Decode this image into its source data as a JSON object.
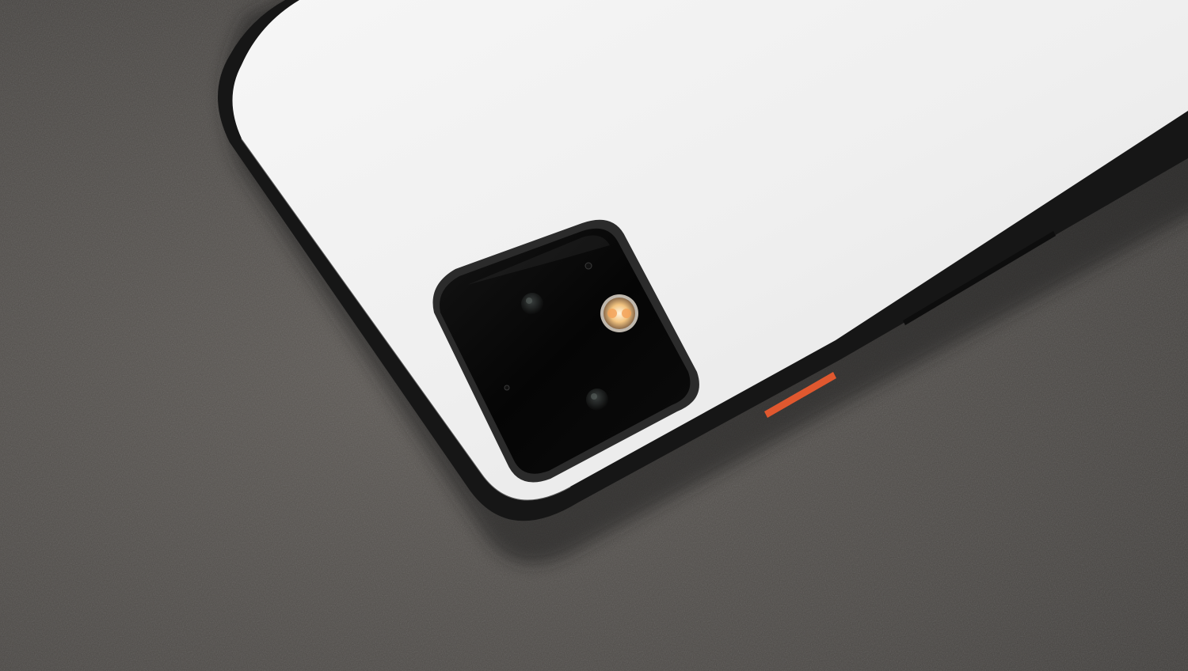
{
  "scene": {
    "subject": "smartphone-back",
    "colors": {
      "surface": "#4a4744",
      "surface_light": "#5e5a56",
      "phone_back": "#f2f2f2",
      "phone_frame": "#1a1a1a",
      "camera_module": "#050505",
      "power_button_accent": "#e0582f",
      "flash_glow": "#f5c27a"
    },
    "icons": {
      "camera_module": "camera-module-icon",
      "flash": "flash-icon",
      "lens": "lens-icon",
      "microphone": "microphone-icon"
    }
  }
}
